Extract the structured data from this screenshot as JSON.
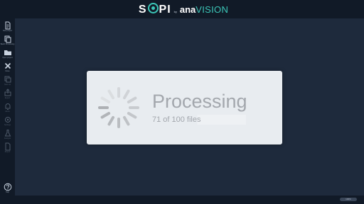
{
  "app": {
    "brand_main": "SOPI",
    "brand_by": "by",
    "brand_ana": "ana",
    "brand_vision": "VISION",
    "accent_color": "#3cc7b8"
  },
  "sidebar": {
    "items": [
      {
        "icon": "document-icon",
        "label": "New project",
        "enabled": true
      },
      {
        "icon": "copy-icon",
        "label": "Batch Processing",
        "enabled": true
      },
      {
        "icon": "folder-icon",
        "label": "Open project",
        "enabled": true
      },
      {
        "icon": "close-icon",
        "label": "Close",
        "enabled": true
      },
      {
        "icon": "duplicate-icon",
        "label": "Save as",
        "enabled": false
      },
      {
        "icon": "export-icon",
        "label": "Export",
        "enabled": false
      },
      {
        "icon": "bell-icon",
        "label": "Alerts",
        "enabled": false
      },
      {
        "icon": "settings-icon",
        "label": "Settings",
        "enabled": false
      },
      {
        "icon": "flask-icon",
        "label": "Analysis",
        "enabled": false
      },
      {
        "icon": "file-icon",
        "label": "Report",
        "enabled": false
      }
    ],
    "help_label": "Help",
    "help_icon": "help-icon"
  },
  "dialog": {
    "title": "Processing",
    "progress_text": "71 of 100 files",
    "processed": 71,
    "total": 100
  },
  "status": {
    "zoom_label": "100%"
  }
}
